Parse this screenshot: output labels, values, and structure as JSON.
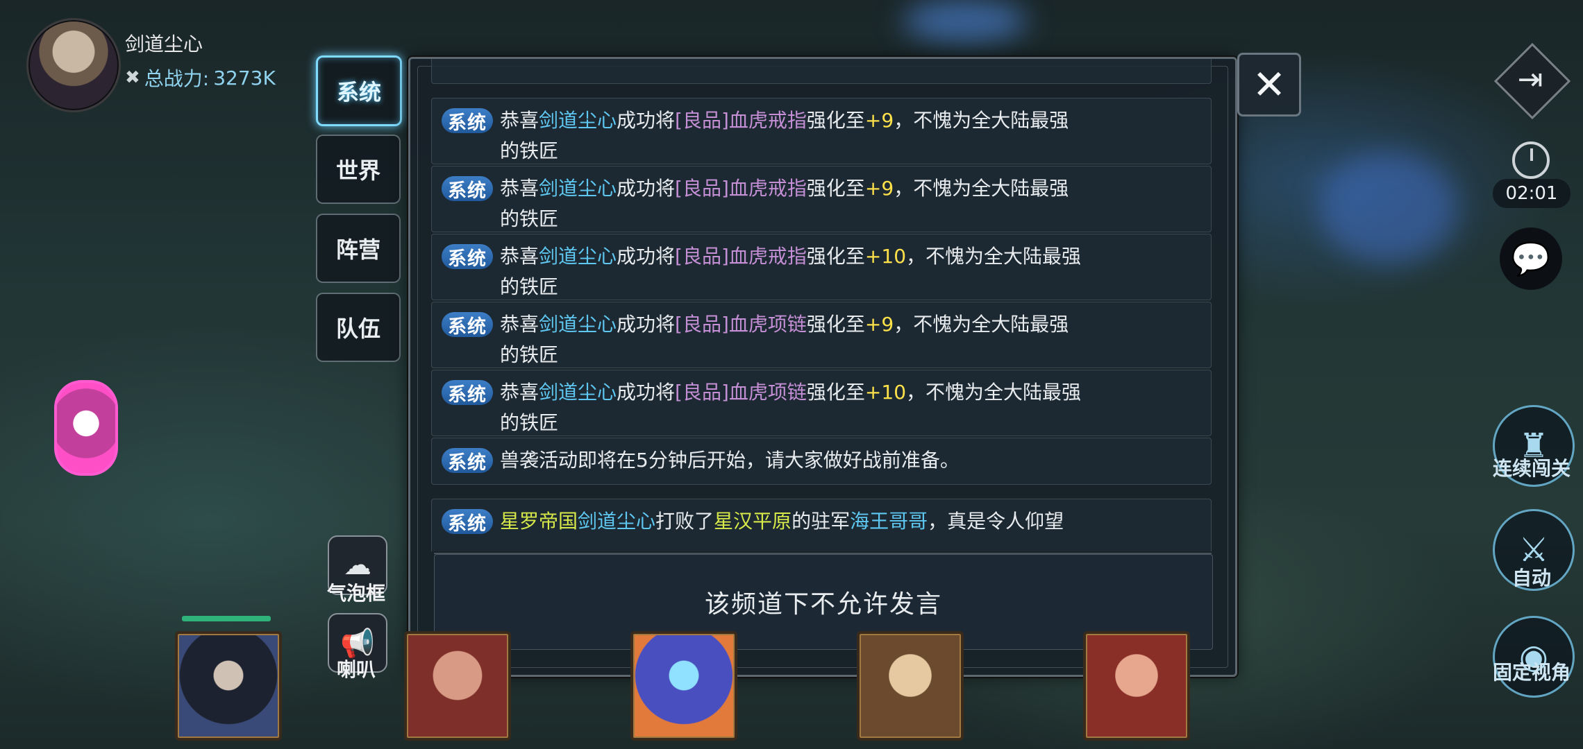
{
  "player": {
    "name": "剑道尘心",
    "power_label": "总战力:",
    "power_value": "3273K"
  },
  "tabs": [
    {
      "label": "系统",
      "active": true
    },
    {
      "label": "世界",
      "active": false
    },
    {
      "label": "阵营",
      "active": false
    },
    {
      "label": "队伍",
      "active": false
    }
  ],
  "messages": [
    {
      "badge": "系统",
      "parts": [
        "恭喜",
        "剑道尘心",
        "成功将",
        "[良品]血虎戒指",
        "强化至",
        "+9",
        "，不愧为全大陆最强"
      ],
      "line2": "的铁匠"
    },
    {
      "badge": "系统",
      "parts": [
        "恭喜",
        "剑道尘心",
        "成功将",
        "[良品]血虎戒指",
        "强化至",
        "+9",
        "，不愧为全大陆最强"
      ],
      "line2": "的铁匠"
    },
    {
      "badge": "系统",
      "parts": [
        "恭喜",
        "剑道尘心",
        "成功将",
        "[良品]血虎戒指",
        "强化至",
        "+10",
        "，不愧为全大陆最强"
      ],
      "line2": "的铁匠"
    },
    {
      "badge": "系统",
      "parts": [
        "恭喜",
        "剑道尘心",
        "成功将",
        "[良品]血虎项链",
        "强化至",
        "+9",
        "，不愧为全大陆最强"
      ],
      "line2": "的铁匠"
    },
    {
      "badge": "系统",
      "parts": [
        "恭喜",
        "剑道尘心",
        "成功将",
        "[良品]血虎项链",
        "强化至",
        "+10",
        "，不愧为全大陆最强"
      ],
      "line2": "的铁匠"
    },
    {
      "badge": "系统",
      "text": "兽袭活动即将在5分钟后开始，请大家做好战前准备。"
    },
    {
      "badge": "系统",
      "parts": [
        "星罗帝国",
        "剑道尘心",
        "打败了",
        "星汉平原",
        "的驻军",
        "海王哥哥",
        "，真是令人仰望"
      ]
    }
  ],
  "input_notice": "该频道下不允许发言",
  "close_symbol": "✕",
  "right": {
    "timer": "02:01",
    "continue_label": "连续闯关",
    "auto_label": "自动",
    "view_label": "固定视角"
  },
  "left": {
    "bubble_label": "气泡框",
    "horn_label": "喇叭"
  },
  "icons": {
    "exit": "exit-icon",
    "timer": "stopwatch-icon",
    "chat": "chat-bubbles-icon",
    "castle": "castle-icon",
    "swords": "crossed-swords-icon",
    "eye": "eye-icon",
    "bubble": "speech-bubble-icon",
    "horn": "megaphone-icon"
  },
  "colors": {
    "name": "#5ec8f2",
    "item": "#c58fd6",
    "number": "#ffe14a",
    "place": "#d8e94a",
    "badge": "#2f6db3",
    "active_tab_glow": "#7fdcff"
  }
}
